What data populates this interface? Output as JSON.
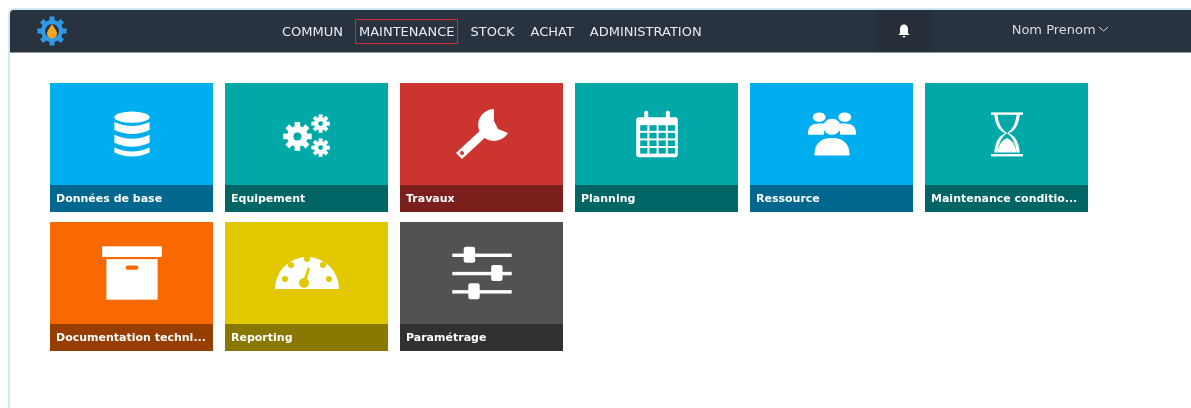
{
  "navbar": {
    "menu": [
      {
        "label": "COMMUN",
        "selected": false
      },
      {
        "label": "MAINTENANCE",
        "selected": true
      },
      {
        "label": "STOCK",
        "selected": false
      },
      {
        "label": "ACHAT",
        "selected": false
      },
      {
        "label": "ADMINISTRATION",
        "selected": false
      }
    ],
    "user": "Nom Prenom"
  },
  "tiles": [
    {
      "label": "Données de base",
      "kind": "database",
      "color": "#00adef"
    },
    {
      "label": "Equipement",
      "kind": "gears",
      "color": "#00a8a8"
    },
    {
      "label": "Travaux",
      "kind": "wrench",
      "color": "#cc3430"
    },
    {
      "label": "Planning",
      "kind": "calendar",
      "color": "#00a8a8"
    },
    {
      "label": "Ressource",
      "kind": "people",
      "color": "#00adef"
    },
    {
      "label": "Maintenance conditio...",
      "kind": "hourglass",
      "color": "#00a8a8"
    },
    {
      "label": "Documentation techni...",
      "kind": "archive",
      "color": "#fa6800"
    },
    {
      "label": "Reporting",
      "kind": "gauge",
      "color": "#e3c800"
    },
    {
      "label": "Paramétrage",
      "kind": "sliders",
      "color": "#525252"
    }
  ]
}
